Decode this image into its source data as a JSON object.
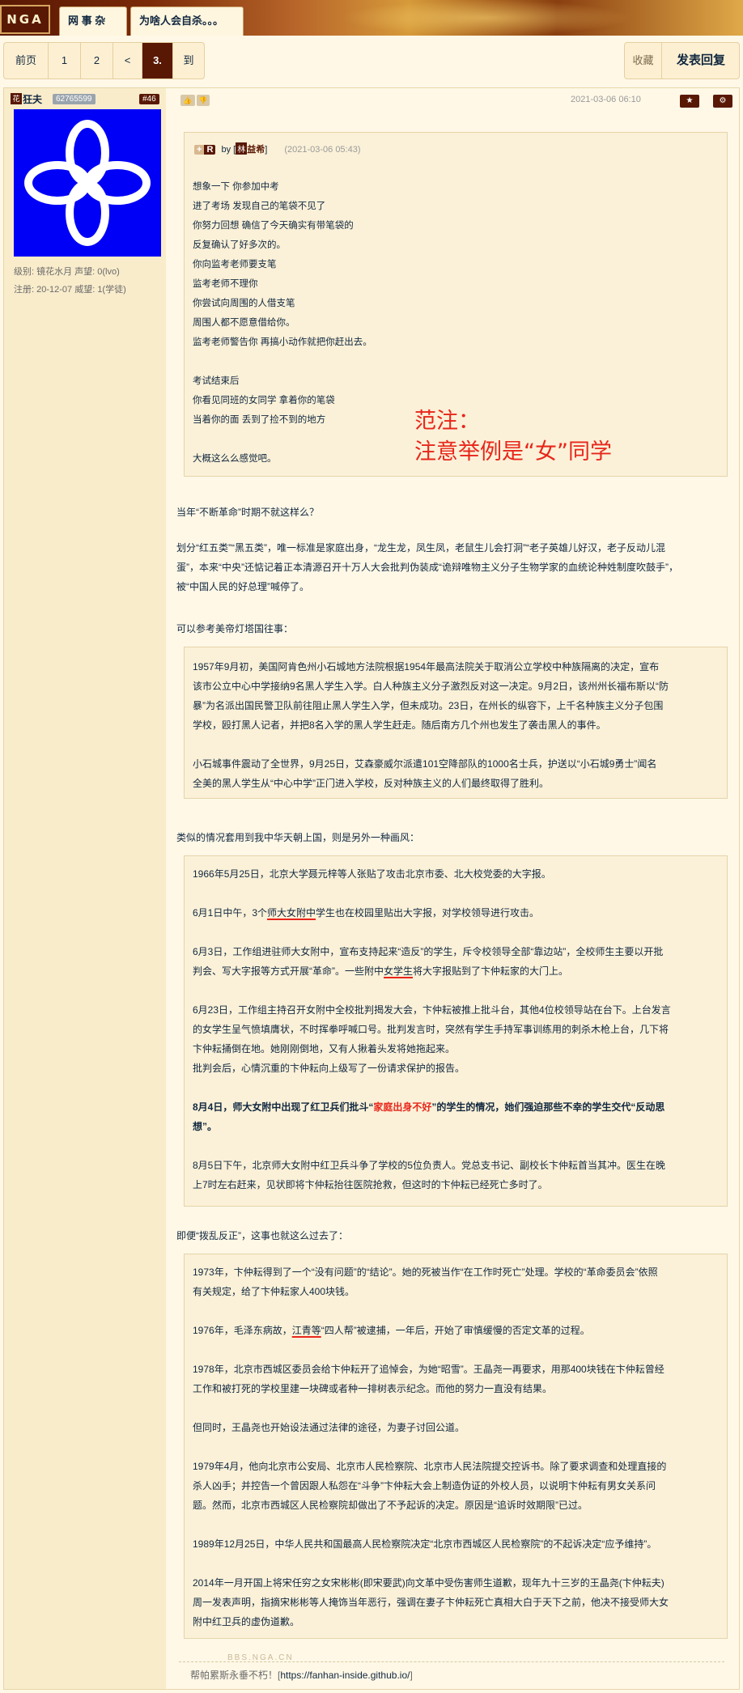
{
  "header": {
    "logo": "NGA",
    "crumbs": [
      "网 事 杂 谈",
      "为啥人会自杀。。。"
    ]
  },
  "pager": {
    "first": "前页",
    "p1": "1",
    "p2": "2",
    "prev": "<",
    "current": "3.",
    "to": "到"
  },
  "actions": {
    "fav": "收藏",
    "reply": "发表回复"
  },
  "user": {
    "icon": "花",
    "name": "狂夫",
    "uid": "62765599",
    "floor": "#46",
    "meta1": "级别: 镜花水月  声望: 0(lvo)",
    "meta2": "注册: 20-12-07 威望: 1(学徒)"
  },
  "post": {
    "date": "2021-03-06 06:10",
    "thumb_up": "👍",
    "thumb_down": "👎",
    "star": "★",
    "gear": "⚙",
    "quote": {
      "plus": "+",
      "r": "R",
      "by": "by",
      "author_icon": "林",
      "author": "益希",
      "time": "(2021-03-06 05:43)",
      "lines": [
        "想象一下 你参加中考",
        "进了考场 发现自己的笔袋不见了",
        "你努力回想 确信了今天确实有带笔袋的",
        "反复确认了好多次的。",
        "你向监考老师要支笔",
        "监考老师不理你",
        "你尝试向周围的人借支笔",
        "周围人都不愿意借给你。",
        "监考老师警告你 再搞小动作就把你赶出去。",
        "考试结束后",
        "你看见同班的女同学 拿着你的笔袋",
        "当着你的面 丢到了捡不到的地方",
        "大概这么么感觉吧。"
      ],
      "annot1": "范注：",
      "annot2": "注意举例是“女”同学"
    },
    "p1": "当年“不断革命”时期不就这样么？",
    "p2a": "划分“红五类”“黑五类”，唯一标准是家庭出身，“龙生龙，凤生凤，老鼠生儿会打洞”“老子英雄儿好汉，老子反动儿混",
    "p2b": "蛋”，本来“中央”还惦记着正本清源召开十万人大会批判伪装成“诡辩唯物主义分子生物学家的血统论种姓制度吹鼓手”，",
    "p2c": "被“中国人民的好总理”喊停了。",
    "p3": "可以参考美帝灯塔国往事：",
    "box1": [
      "1957年9月初，美国阿肯色州小石城地方法院根据1954年最高法院关于取消公立学校中种族隔离的决定，宣布",
      "该市公立中心中学接纳9名黑人学生入学。白人种族主义分子激烈反对这一决定。9月2日，该州州长福布斯以“防",
      "暴”为名派出国民警卫队前往阻止黑人学生入学，但未成功。23日，在州长的纵容下，上千名种族主义分子包围",
      "学校，殴打黑人记者，并把8名入学的黑人学生赶走。随后南方几个州也发生了袭击黑人的事件。",
      "小石城事件震动了全世界，9月25日，艾森豪威尔派遣101空降部队的1000名士兵，护送以“小石城9勇士”闻名",
      "全美的黑人学生从“中心中学”正门进入学校，反对种族主义的人们最终取得了胜利。"
    ],
    "p4": "类似的情况套用到我中华天朝上国，则是另外一种画风：",
    "box2": {
      "l1": "1966年5月25日，北京大学聂元梓等人张贴了攻击北京市委、北大校党委的大字报。",
      "l2a": "6月1日中午，3个",
      "l2b": "师大女附中",
      "l2c": "学生也在校园里贴出大字报，对学校领导进行攻击。",
      "l3": "6月3日，工作组进驻师大女附中，宣布支持起来“造反”的学生，斥令校领导全部“靠边站”，全校师生主要以开批",
      "l4a": "判会、写大字报等方式开展“革命”。一些附中",
      "l4b": "女学生",
      "l4c": "将大字报贴到了卞仲耘家的大门上。",
      "l5": "6月23日，工作组主持召开女附中全校批判揭发大会，卞仲耘被推上批斗台，其他4位校领导站在台下。上台发言",
      "l6": "的女学生呈气愤填膺状，不时挥拳呼喊口号。批判发言时，突然有学生手持军事训练用的刺杀木枪上台，几下将",
      "l7": "卞仲耘捅倒在地。她刚刚倒地，又有人揪着头发将她拖起来。",
      "l8": "批判会后，心情沉重的卞仲耘向上级写了一份请求保护的报告。",
      "l9a": "8月4日，师大女附中出现了红卫兵们批斗“",
      "l9b": "家庭出身不好",
      "l9c": "”的学生的情况，她们强迫那些不幸的学生交代“反动思",
      "l10": "想”。",
      "l11": "8月5日下午，北京师大女附中红卫兵斗争了学校的5位负责人。党总支书记、副校长卞仲耘首当其冲。医生在晚",
      "l12": "上7时左右赶来，见状即将卞仲耘抬往医院抢救，但这时的卞仲耘已经死亡多时了。"
    },
    "p5": "即便“拨乱反正”，这事也就这么过去了：",
    "box3": {
      "l1": "1973年，卞仲耘得到了一个“没有问题”的“结论”。她的死被当作“在工作时死亡”处理。学校的“革命委员会”依照",
      "l2": "有关规定，给了卞仲耘家人400块钱。",
      "l3a": "1976年，毛泽东病故，",
      "l3b": "江青等",
      "l3c": "“四人帮”被逮捕，一年后，开始了审慎缓慢的否定文革的过程。",
      "l4": "1978年，北京市西城区委员会给卞仲耘开了追悼会，为她“昭雪”。王晶尧一再要求，用那400块钱在卞仲耘曾经",
      "l5": "工作和被打死的学校里建一块碑或者种一排树表示纪念。而他的努力一直没有结果。",
      "l6": "但同时，王晶尧也开始设法通过法律的途径，为妻子讨回公道。",
      "l7": "1979年4月，他向北京市公安局、北京市人民检察院、北京市人民法院提交控诉书。除了要求调查和处理直接的",
      "l8": "杀人凶手；并控告一个曾因跟人私怨在“斗争”卞仲耘大会上制造伪证的外校人员，以说明卞仲耘有男女关系问",
      "l9": "题。然而，北京市西城区人民检察院却做出了不予起诉的决定。原因是“追诉时效期限”已过。",
      "l10": "1989年12月25日，中华人民共和国最高人民检察院决定“北京市西城区人民检察院”的不起诉决定“应予维持”。",
      "l11": "2014年一月开国上将宋任穷之女宋彬彬(即宋要武)向文革中受伤害师生道歉，现年九十三岁的王晶尧(卞仲耘夫)",
      "l12": "周一发表声明，指摘宋彬彬等人掩饰当年恶行，强调在妻子卞仲耘死亡真相大白于天下之前，他决不接受师大女",
      "l13": "附中红卫兵的虚伪道歉。"
    },
    "foot_mark": "BBS.NGA.CN",
    "sig_text": "帮帕累斯永垂不朽！[",
    "sig_link": "https://fanhan-inside.github.io/",
    "sig_end": "]"
  }
}
